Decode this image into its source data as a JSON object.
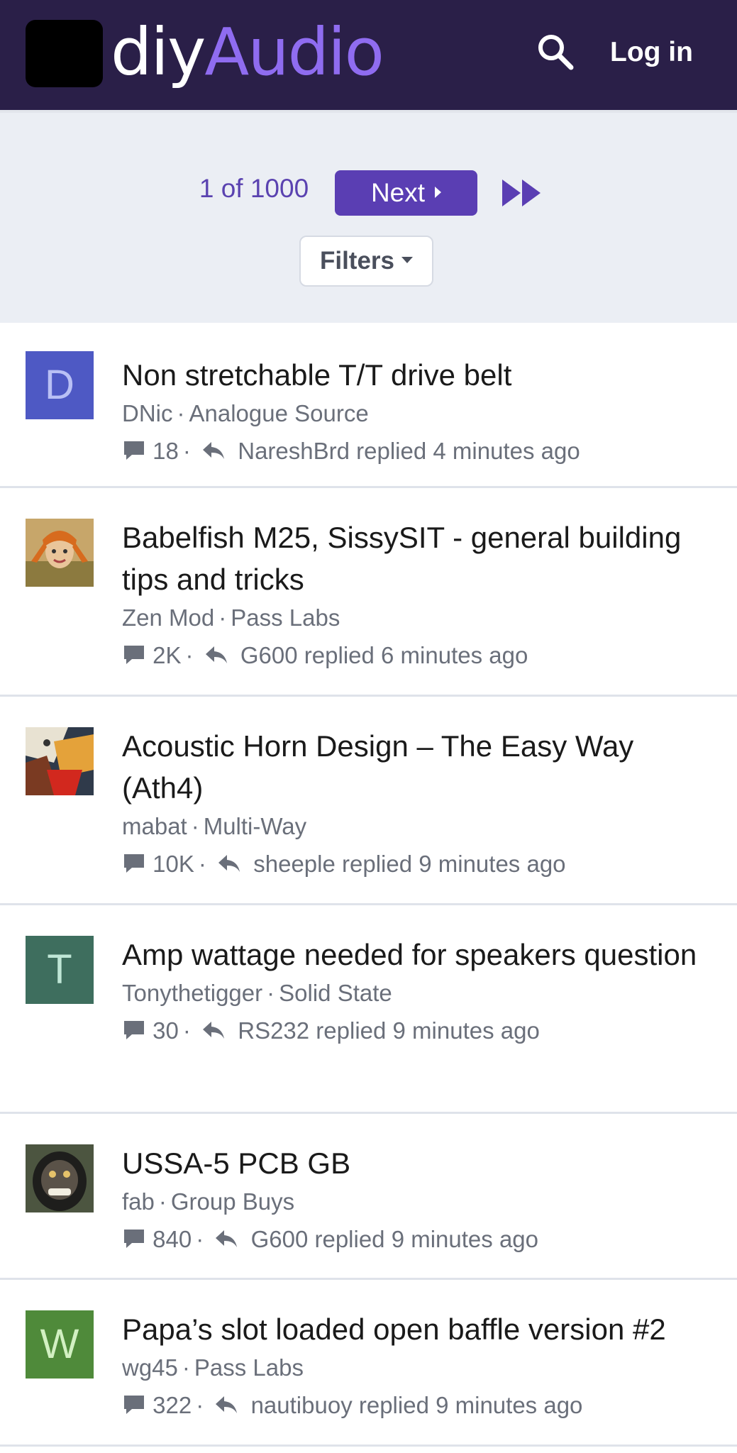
{
  "header": {
    "logo_part1": "diy",
    "logo_part2": "Audio",
    "login_label": "Log in",
    "search_icon": "search-icon"
  },
  "pager": {
    "page_count": "1 of 1000",
    "next_label": "Next",
    "filters_label": "Filters"
  },
  "colors": {
    "header_bg": "#2a1f48",
    "accent": "#5a3eb3",
    "logo_accent": "#8f6cf0"
  },
  "threads": [
    {
      "title": "Non stretchable T/T drive belt",
      "author": "DNic",
      "forum": "Analogue Source",
      "replies": "18",
      "last_reply": "NareshBrd replied 4 minutes ago",
      "avatar_letter": "D",
      "avatar_color": "#4e59c4"
    },
    {
      "title": "Babelfish M25, SissySIT - general building tips and tricks",
      "author": "Zen Mod",
      "forum": "Pass Labs",
      "replies": "2K",
      "last_reply": "G600 replied 6 minutes ago",
      "avatar_letter": "",
      "avatar_color": "#c7944a"
    },
    {
      "title": "Acoustic Horn Design – The Easy Way (Ath4)",
      "author": "mabat",
      "forum": "Multi-Way",
      "replies": "10K",
      "last_reply": "sheeple replied 9 minutes ago",
      "avatar_letter": "",
      "avatar_color": "#b8552c"
    },
    {
      "title": "Amp wattage needed for speakers question",
      "author": "Tonythetigger",
      "forum": "Solid State",
      "replies": "30",
      "last_reply": "RS232 replied 9 minutes ago",
      "avatar_letter": "T",
      "avatar_color": "#3e6e5e"
    },
    {
      "title": "USSA-5 PCB GB",
      "author": "fab",
      "forum": "Group Buys",
      "replies": "840",
      "last_reply": "G600 replied 9 minutes ago",
      "avatar_letter": "",
      "avatar_color": "#3b3d33"
    },
    {
      "title": "Papa’s slot loaded open baffle version #2",
      "author": "wg45",
      "forum": "Pass Labs",
      "replies": "322",
      "last_reply": "nautibuoy replied 9 minutes ago",
      "avatar_letter": "W",
      "avatar_color": "#4f8a3a"
    }
  ]
}
